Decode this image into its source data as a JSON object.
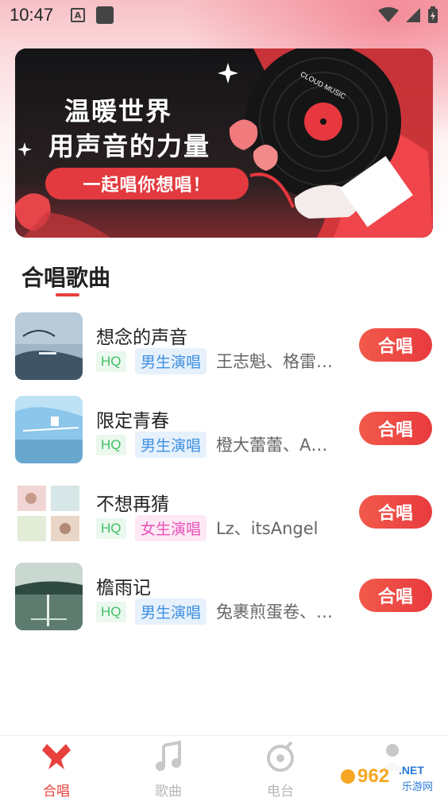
{
  "status_bar": {
    "time": "10:47",
    "a_icon": "A"
  },
  "banner": {
    "line1": "温暖世界",
    "line2": "用声音的力量",
    "pill": "一起唱你想唱！",
    "record_label": "CLOUD MUSIC"
  },
  "section": {
    "title": "合唱歌曲"
  },
  "songs": [
    {
      "title": "想念的声音",
      "quality": "HQ",
      "type": "男生演唱",
      "gender": "male",
      "artists": "王志魁、格雷…",
      "button": "合唱"
    },
    {
      "title": "限定青春",
      "quality": "HQ",
      "type": "男生演唱",
      "gender": "male",
      "artists": "橙大蕾蕾、A…",
      "button": "合唱"
    },
    {
      "title": "不想再猜",
      "quality": "HQ",
      "type": "女生演唱",
      "gender": "female",
      "artists": "Lz、itsAngel",
      "button": "合唱"
    },
    {
      "title": "檐雨记",
      "quality": "HQ",
      "type": "男生演唱",
      "gender": "male",
      "artists": "兔裹煎蛋卷、…",
      "button": "合唱"
    }
  ],
  "tabs": [
    {
      "label": "合唱",
      "icon": "chorus-icon",
      "active": true
    },
    {
      "label": "歌曲",
      "icon": "music-note-icon",
      "active": false
    },
    {
      "label": "电台",
      "icon": "radio-icon",
      "active": false
    },
    {
      "label": "",
      "icon": "profile-icon",
      "active": false
    }
  ],
  "watermark": {
    "brand": "962",
    "suffix": ".NET",
    "sub": "乐游网"
  },
  "colors": {
    "accent": "#e8403d",
    "male_tag": "#3f8fe0",
    "female_tag": "#e851b8",
    "hq_tag": "#3fbf64"
  }
}
